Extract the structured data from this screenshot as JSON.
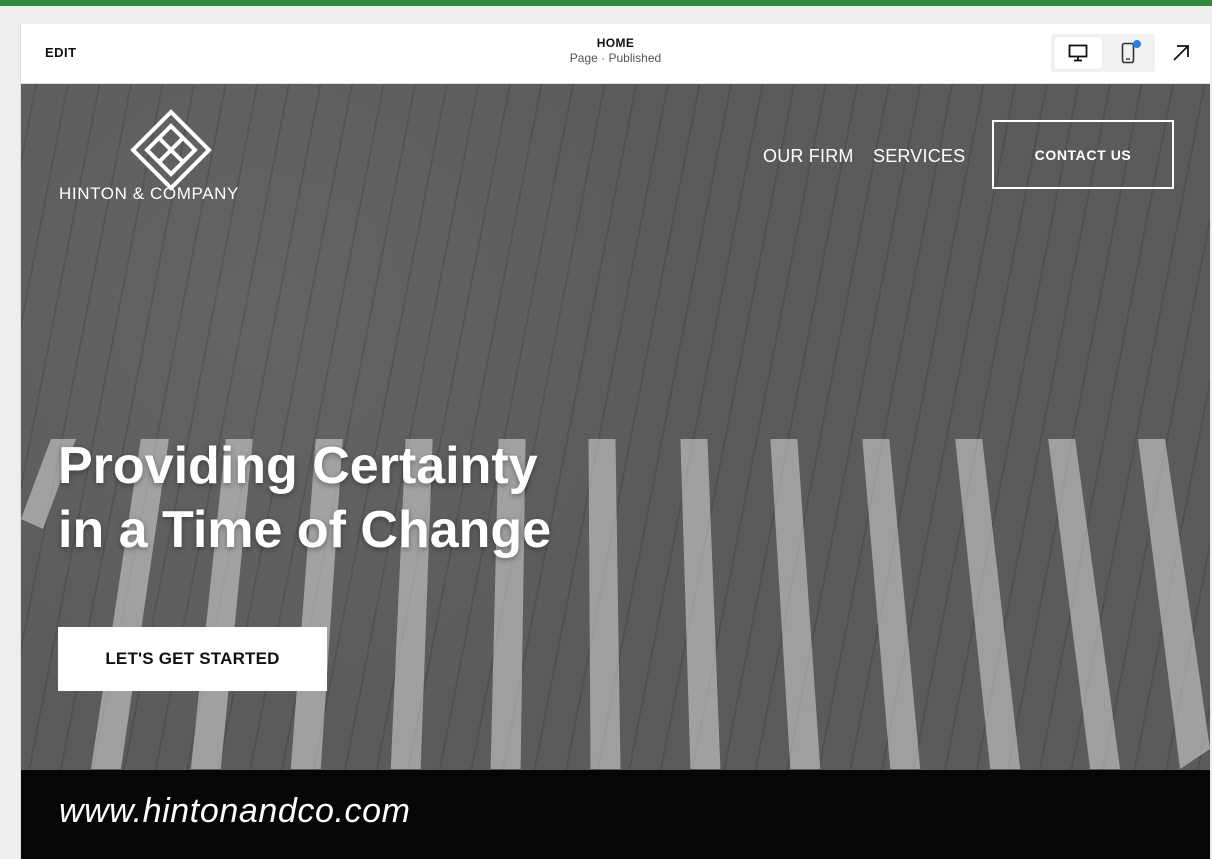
{
  "editor": {
    "edit_label": "EDIT",
    "page_name": "HOME",
    "page_status": "Page · Published",
    "view_modes": [
      "desktop-icon",
      "mobile-icon"
    ],
    "active_view": "desktop",
    "mobile_notification": true,
    "expand_icon": "arrow-up-right-icon"
  },
  "site": {
    "logo_icon": "diamond-knot-logo",
    "brand_name": "HINTON & COMPANY",
    "nav": {
      "our_firm": "OUR FIRM",
      "services": "SERVICES",
      "contact": "CONTACT US"
    },
    "hero": {
      "headline_line1": "Providing Certainty",
      "headline_line2": "in a Time of Change",
      "cta_label": "LET'S GET STARTED"
    },
    "footer_url": "www.hintonandco.com"
  },
  "colors": {
    "accent_line": "#2f8a3a",
    "notification_dot": "#2a7de1",
    "footer_band": "#060606"
  }
}
